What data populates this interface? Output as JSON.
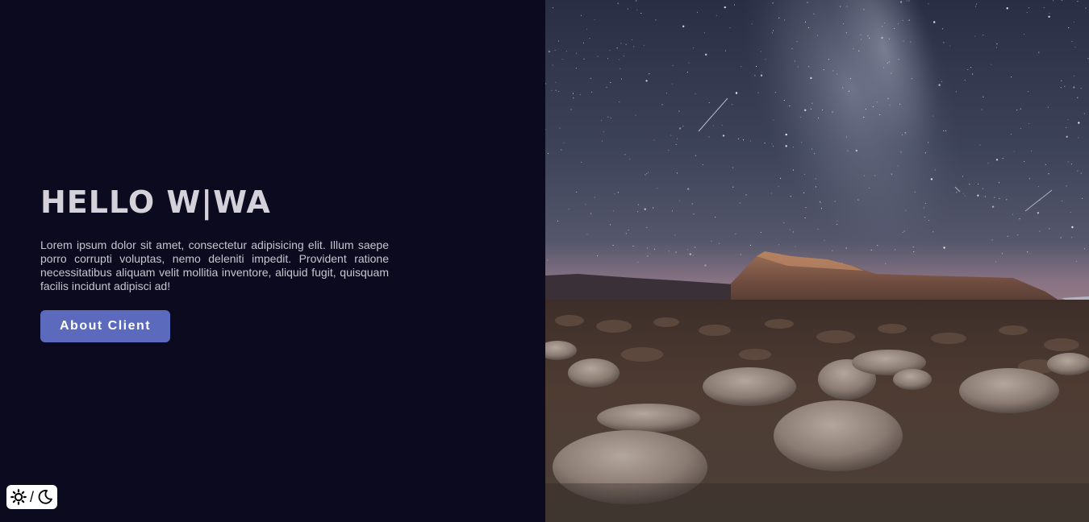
{
  "hero": {
    "title": "HELLO W|WA",
    "description": "Lorem ipsum dolor sit amet, consectetur adipisicing elit. Illum saepe porro corrupti voluptas, nemo deleniti impedit. Provident ratione necessitatibus aliquam velit mollitia inventore, aliquid fugit, quisquam facilis incidunt adipisci ad!",
    "button_label": "About Client"
  },
  "theme_toggle": {
    "light_icon": "sun-icon",
    "separator": "/",
    "dark_icon": "moon-icon"
  },
  "colors": {
    "background": "#0b0a1e",
    "accent": "#5b6abd",
    "title": "#d4d1db"
  }
}
